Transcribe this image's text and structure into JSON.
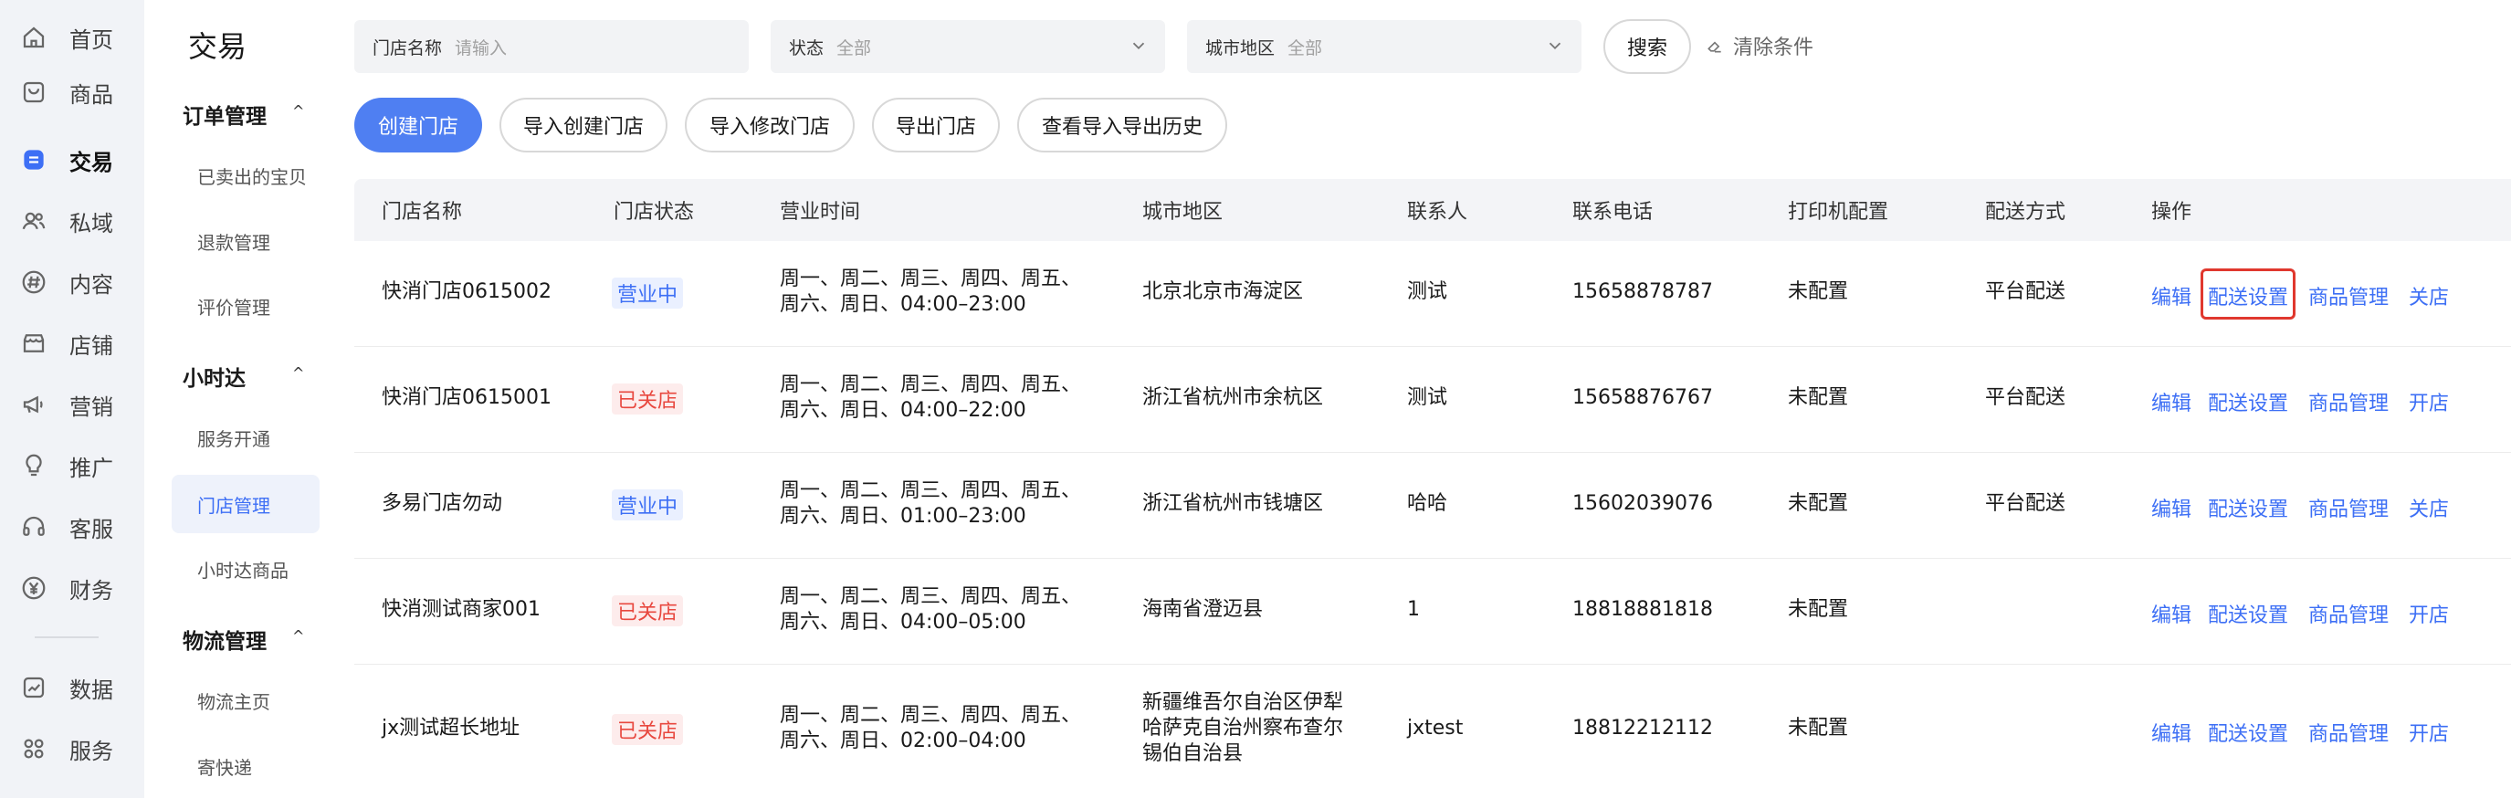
{
  "rail": {
    "items": [
      {
        "label": "首页",
        "icon": "home-icon"
      },
      {
        "label": "商品",
        "icon": "bag-icon"
      },
      {
        "label": "交易",
        "icon": "trade-icon"
      },
      {
        "label": "私域",
        "icon": "users-icon"
      },
      {
        "label": "内容",
        "icon": "hashtag-icon"
      },
      {
        "label": "店铺",
        "icon": "store-icon"
      },
      {
        "label": "营销",
        "icon": "megaphone-icon"
      },
      {
        "label": "推广",
        "icon": "bulb-icon"
      },
      {
        "label": "客服",
        "icon": "headset-icon"
      },
      {
        "label": "财务",
        "icon": "yen-icon"
      },
      {
        "label": "数据",
        "icon": "chart-icon"
      },
      {
        "label": "服务",
        "icon": "grid-icon"
      }
    ],
    "active": "交易"
  },
  "sidebar": {
    "title": "交易",
    "groups": [
      {
        "label": "订单管理",
        "items": [
          "已卖出的宝贝",
          "退款管理",
          "评价管理"
        ]
      },
      {
        "label": "小时达",
        "items": [
          "服务开通",
          "门店管理",
          "小时达商品"
        ]
      },
      {
        "label": "物流管理",
        "items": [
          "物流主页",
          "寄快递"
        ]
      }
    ],
    "active_item": "门店管理"
  },
  "filters": {
    "store_name": {
      "label": "门店名称",
      "placeholder": "请输入"
    },
    "status": {
      "label": "状态",
      "value": "全部"
    },
    "region": {
      "label": "城市地区",
      "value": "全部"
    },
    "search_label": "搜索",
    "clear_label": "清除条件"
  },
  "actions": {
    "create": "创建门店",
    "import_create": "导入创建门店",
    "import_modify": "导入修改门店",
    "export": "导出门店",
    "history": "查看导入导出历史"
  },
  "table": {
    "columns": [
      "门店名称",
      "门店状态",
      "营业时间",
      "城市地区",
      "联系人",
      "联系电话",
      "打印机配置",
      "配送方式",
      "操作"
    ],
    "rows": [
      {
        "name": "快消门店0615002",
        "status": "营业中",
        "status_type": "open",
        "hours_line1": "周一、周二、周三、周四、周五、",
        "hours_line2": "周六、周日、04:00–23:00",
        "region_lines": [
          "北京北京市海淀区"
        ],
        "contact": "测试",
        "phone": "15658878787",
        "printer": "未配置",
        "delivery": "平台配送",
        "ops": [
          "编辑",
          "配送设置",
          "商品管理",
          "关店"
        ]
      },
      {
        "name": "快消门店0615001",
        "status": "已关店",
        "status_type": "closed",
        "hours_line1": "周一、周二、周三、周四、周五、",
        "hours_line2": "周六、周日、04:00–22:00",
        "region_lines": [
          "浙江省杭州市余杭区"
        ],
        "contact": "测试",
        "phone": "15658876767",
        "printer": "未配置",
        "delivery": "平台配送",
        "ops": [
          "编辑",
          "配送设置",
          "商品管理",
          "开店"
        ]
      },
      {
        "name": "多易门店勿动",
        "status": "营业中",
        "status_type": "open",
        "hours_line1": "周一、周二、周三、周四、周五、",
        "hours_line2": "周六、周日、01:00–23:00",
        "region_lines": [
          "浙江省杭州市钱塘区"
        ],
        "contact": "哈哈",
        "phone": "15602039076",
        "printer": "未配置",
        "delivery": "平台配送",
        "ops": [
          "编辑",
          "配送设置",
          "商品管理",
          "关店"
        ]
      },
      {
        "name": "快消测试商家001",
        "status": "已关店",
        "status_type": "closed",
        "hours_line1": "周一、周二、周三、周四、周五、",
        "hours_line2": "周六、周日、04:00–05:00",
        "region_lines": [
          "海南省澄迈县"
        ],
        "contact": "1",
        "phone": "18818881818",
        "printer": "未配置",
        "delivery": "",
        "ops": [
          "编辑",
          "配送设置",
          "商品管理",
          "开店"
        ]
      },
      {
        "name": "jx测试超长地址",
        "status": "已关店",
        "status_type": "closed",
        "hours_line1": "周一、周二、周三、周四、周五、",
        "hours_line2": "周六、周日、02:00–04:00",
        "region_lines": [
          "新疆维吾尔自治区伊犁",
          "哈萨克自治州察布查尔",
          "锡伯自治县"
        ],
        "contact": "jxtest",
        "phone": "18812212112",
        "printer": "未配置",
        "delivery": "",
        "ops": [
          "编辑",
          "配送设置",
          "商品管理",
          "开店"
        ]
      }
    ]
  },
  "colors": {
    "accent": "#4f7ff2",
    "link": "#3d6ff5",
    "danger": "#e8483f",
    "highlight": "#e0382e"
  }
}
